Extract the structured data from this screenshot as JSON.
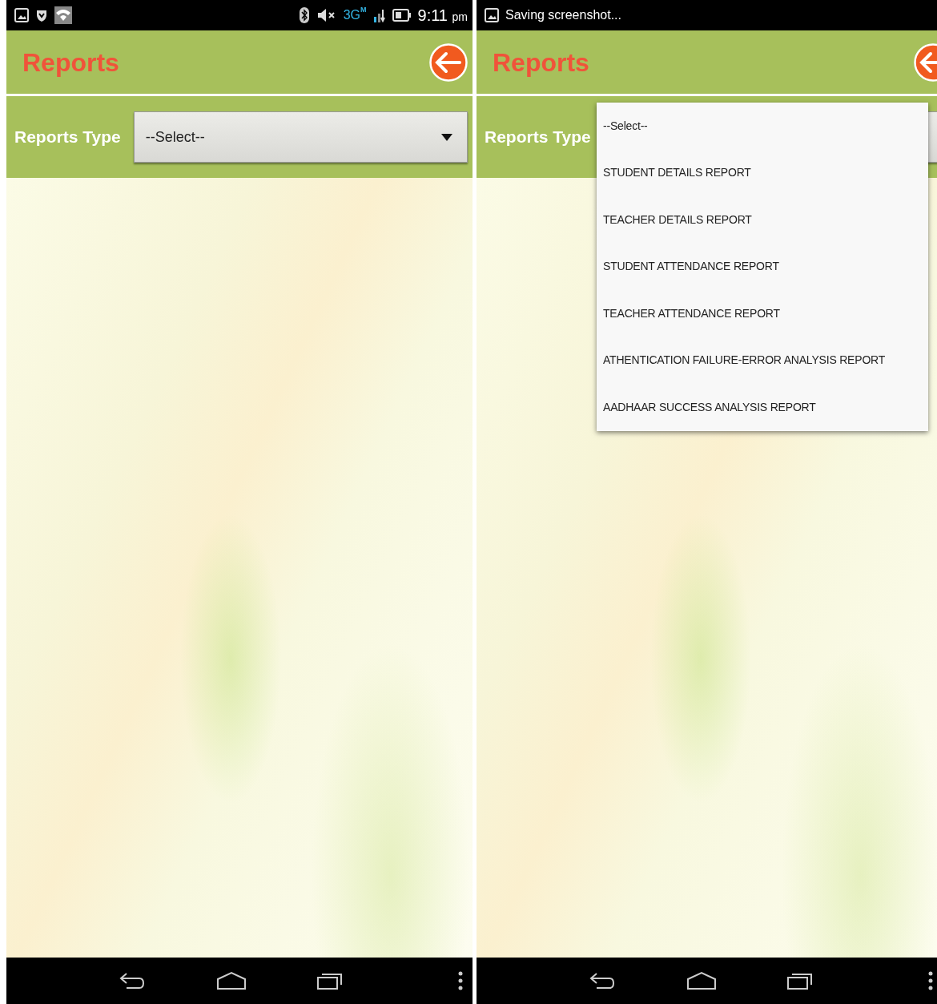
{
  "screens": [
    {
      "status_bar": {
        "kind": "icons",
        "network": "3G",
        "network_mode": "M",
        "time": "9:11",
        "period": "pm"
      },
      "title": "Reports",
      "field_label": "Reports Type",
      "spinner": {
        "expanded": false,
        "value": "--Select--"
      }
    },
    {
      "status_bar": {
        "kind": "notification",
        "text": "Saving screenshot..."
      },
      "title": "Reports",
      "field_label": "Reports Type",
      "spinner": {
        "expanded": true,
        "options": [
          "--Select--",
          "STUDENT DETAILS REPORT",
          "TEACHER DETAILS REPORT",
          "STUDENT ATTENDANCE REPORT",
          "TEACHER ATTENDANCE REPORT",
          "ATHENTICATION FAILURE-ERROR ANALYSIS REPORT",
          "AADHAAR SUCCESS ANALYSIS REPORT"
        ]
      }
    }
  ]
}
